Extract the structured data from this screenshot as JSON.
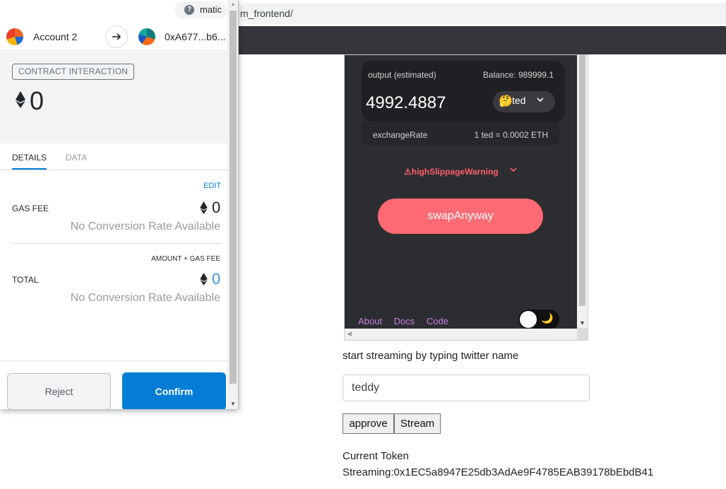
{
  "browser": {
    "url_fragment": "m_frontend/"
  },
  "metamask": {
    "network": "matic",
    "from_account": "Account 2",
    "to_address": "0xA677...b6...",
    "badge": "CONTRACT INTERACTION",
    "amount": "0",
    "tabs": [
      "DETAILS",
      "DATA"
    ],
    "edit_label": "EDIT",
    "gas_fee_label": "GAS FEE",
    "gas_fee_value": "0",
    "no_conversion": "No Conversion Rate Available",
    "amount_plus_gas_label": "AMOUNT + GAS FEE",
    "total_label": "TOTAL",
    "total_value": "0",
    "reject_label": "Reject",
    "confirm_label": "Confirm"
  },
  "dapp": {
    "output_label": "output (estimated)",
    "balance": "Balance: 989999.1",
    "output_amount": "4992.4887",
    "token_emoji": "🤔",
    "token_name": "ted",
    "exchange_rate_label": "exchangeRate",
    "exchange_rate_value": "1 ted = 0.0002 ETH",
    "warning": "⚠highSlippageWarning",
    "swap_label": "swapAnyway",
    "links": [
      "About",
      "Docs",
      "Code"
    ],
    "theme_icon": "moon-icon"
  },
  "page": {
    "stream_prompt": "start streaming by typing twitter name",
    "twitter_input_value": "teddy",
    "approve_label": "approve",
    "stream_label": "Stream",
    "current_token_line1": "Current Token",
    "current_token_line2": "Streaming:0x1EC5a8947E25db3AdAe9F4785EAB39178bEbdB41"
  },
  "colors": {
    "metamask_blue": "#037dd6",
    "swap_button": "#fd6a73",
    "dapp_bg": "#2c2d31",
    "link_purple": "#c77ee0"
  }
}
